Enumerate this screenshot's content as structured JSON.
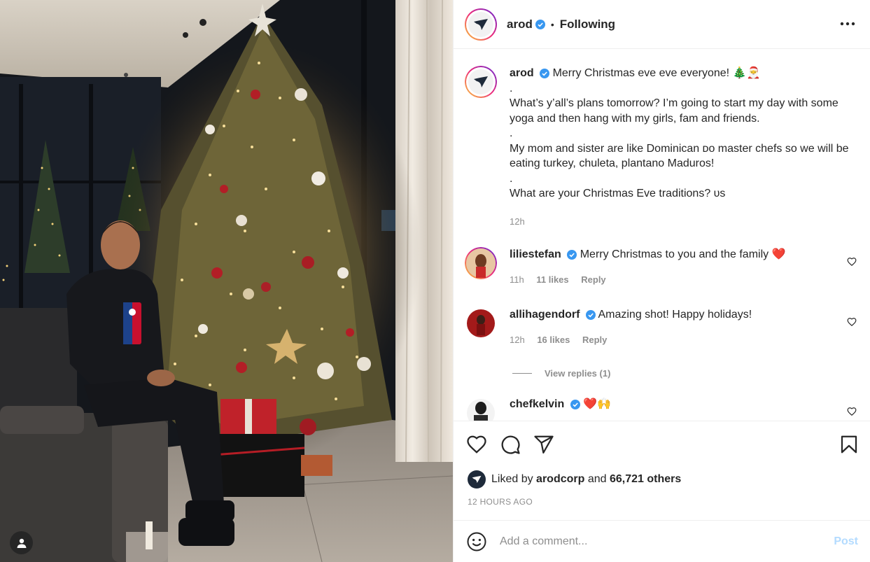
{
  "header": {
    "username": "arod",
    "separator": "•",
    "follow_status": "Following",
    "more_icon": "more-horizontal-icon"
  },
  "caption": {
    "username": "arod",
    "lines": [
      "Merry Christmas eve eve everyone! 🎄🎅",
      ".",
      "What’s y’all’s plans tomorrow? I’m going to start my day with some yoga and then hang with my girls, fam and friends.",
      ".",
      "My mom and sister are like Dominican ᴅᴏ master chefs so we will be eating turkey, chuleta, plantano Maduros!",
      ".",
      "What are your Christmas Eve traditions? ᴜs"
    ],
    "time": "12h"
  },
  "comments": [
    {
      "username": "liliestefan",
      "text": "Merry Christmas to you and the family ❤️",
      "time": "11h",
      "likes": "11 likes",
      "reply": "Reply"
    },
    {
      "username": "allihagendorf",
      "text": "Amazing shot! Happy holidays!",
      "time": "12h",
      "likes": "16 likes",
      "reply": "Reply",
      "view_replies": "View replies (1)"
    },
    {
      "username": "chefkelvin",
      "text": "❤️🙌"
    }
  ],
  "likes": {
    "prefix": "Liked by",
    "user": "arodcorp",
    "and": "and",
    "others": "66,721 others"
  },
  "timestamp": "12 HOURS AGO",
  "comment_box": {
    "placeholder": "Add a comment...",
    "post_label": "Post"
  },
  "colors": {
    "verified": "#3897f0",
    "link_disabled": "#b3dbff",
    "heart_red": "#ed4956"
  }
}
